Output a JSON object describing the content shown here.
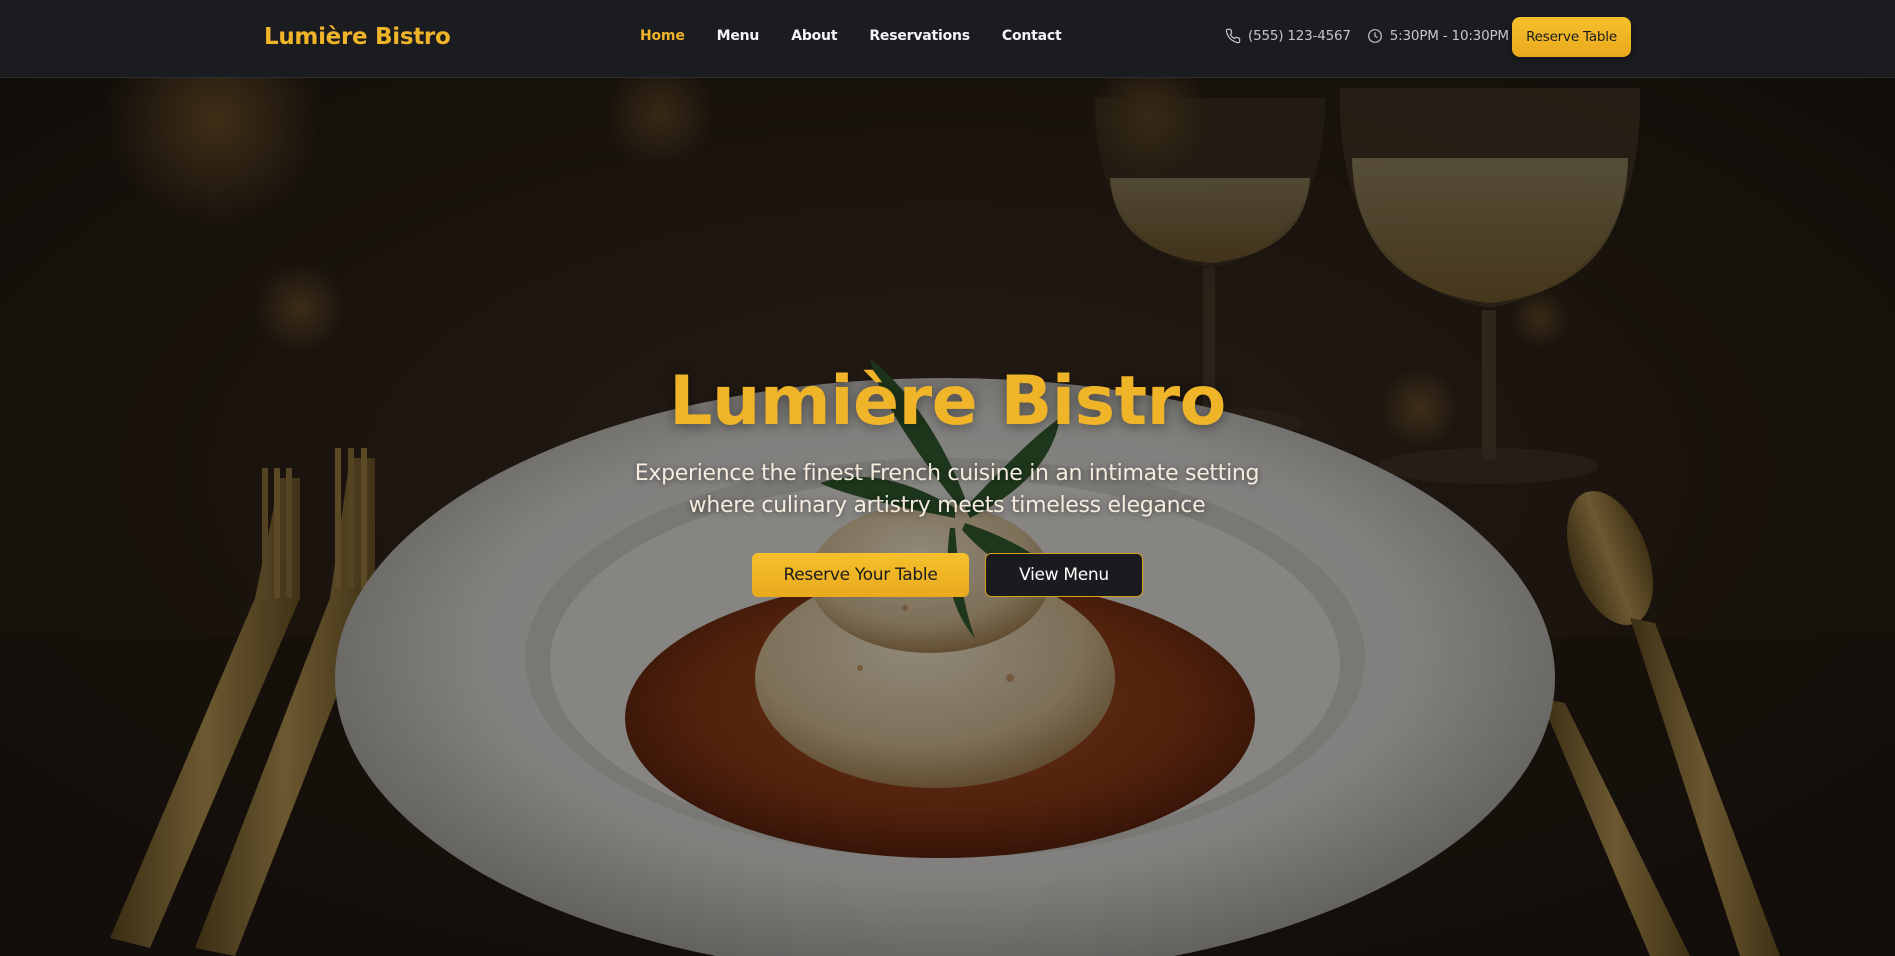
{
  "brand": {
    "name": "Lumière Bistro"
  },
  "nav": {
    "items": [
      {
        "label": "Home",
        "active": true
      },
      {
        "label": "Menu"
      },
      {
        "label": "About"
      },
      {
        "label": "Reservations"
      },
      {
        "label": "Contact"
      }
    ]
  },
  "contact": {
    "phone": "(555) 123-4567",
    "hours": "5:30PM - 10:30PM",
    "phone_icon": "phone-icon",
    "hours_icon": "clock-icon"
  },
  "header_cta": {
    "label": "Reserve Table"
  },
  "hero": {
    "title": "Lumière Bistro",
    "subtitle_line1": "Experience the finest French cuisine in an intimate setting",
    "subtitle_line2": "where culinary artistry meets timeless elegance",
    "primary_button": "Reserve Your Table",
    "secondary_button": "View Menu"
  },
  "colors": {
    "accent": "#f0b429",
    "header_bg": "#1a1c20",
    "dark_button": "#1a1b1e",
    "text_light": "#f3f4f6"
  }
}
